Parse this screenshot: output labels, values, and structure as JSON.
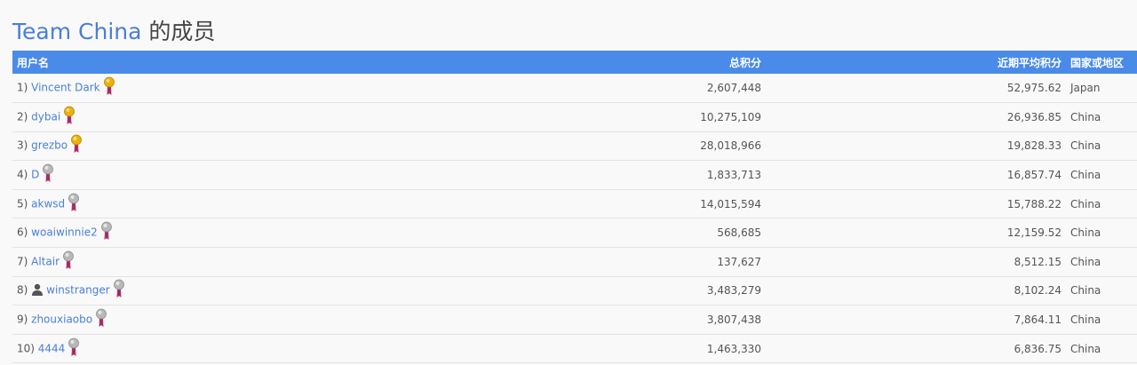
{
  "title": {
    "team": "Team China",
    "suffix": "的成员"
  },
  "table": {
    "headers": {
      "user": "用户名",
      "total": "总积分",
      "recent_avg": "近期平均积分",
      "country": "国家或地区"
    },
    "rows": [
      {
        "rank": "1)",
        "name": "Vincent Dark",
        "has_avatar": false,
        "medal": "gold",
        "total": "2,607,448",
        "recent_avg": "52,975.62",
        "country": "Japan"
      },
      {
        "rank": "2)",
        "name": "dybai",
        "has_avatar": false,
        "medal": "gold",
        "total": "10,275,109",
        "recent_avg": "26,936.85",
        "country": "China"
      },
      {
        "rank": "3)",
        "name": "grezbo",
        "has_avatar": false,
        "medal": "gold",
        "total": "28,018,966",
        "recent_avg": "19,828.33",
        "country": "China"
      },
      {
        "rank": "4)",
        "name": "D",
        "has_avatar": false,
        "medal": "silver",
        "total": "1,833,713",
        "recent_avg": "16,857.74",
        "country": "China"
      },
      {
        "rank": "5)",
        "name": "akwsd",
        "has_avatar": false,
        "medal": "silver",
        "total": "14,015,594",
        "recent_avg": "15,788.22",
        "country": "China"
      },
      {
        "rank": "6)",
        "name": "woaiwinnie2",
        "has_avatar": false,
        "medal": "silver",
        "total": "568,685",
        "recent_avg": "12,159.52",
        "country": "China"
      },
      {
        "rank": "7)",
        "name": "Altair",
        "has_avatar": false,
        "medal": "silver",
        "total": "137,627",
        "recent_avg": "8,512.15",
        "country": "China"
      },
      {
        "rank": "8)",
        "name": "winstranger",
        "has_avatar": true,
        "medal": "silver",
        "total": "3,483,279",
        "recent_avg": "8,102.24",
        "country": "China"
      },
      {
        "rank": "9)",
        "name": "zhouxiaobo",
        "has_avatar": false,
        "medal": "silver",
        "total": "3,807,438",
        "recent_avg": "7,864.11",
        "country": "China"
      },
      {
        "rank": "10)",
        "name": "4444",
        "has_avatar": false,
        "medal": "silver",
        "total": "1,463,330",
        "recent_avg": "6,836.75",
        "country": "China"
      }
    ]
  },
  "colors": {
    "link": "#4a7fd8",
    "header_bg": "#4a8ae8",
    "gold_medal": "#e8b20c",
    "silver_medal": "#b8b8b8",
    "ribbon": "#c0305a"
  },
  "icons": {
    "medal": "medal-icon",
    "avatar": "user-silhouette-icon"
  }
}
